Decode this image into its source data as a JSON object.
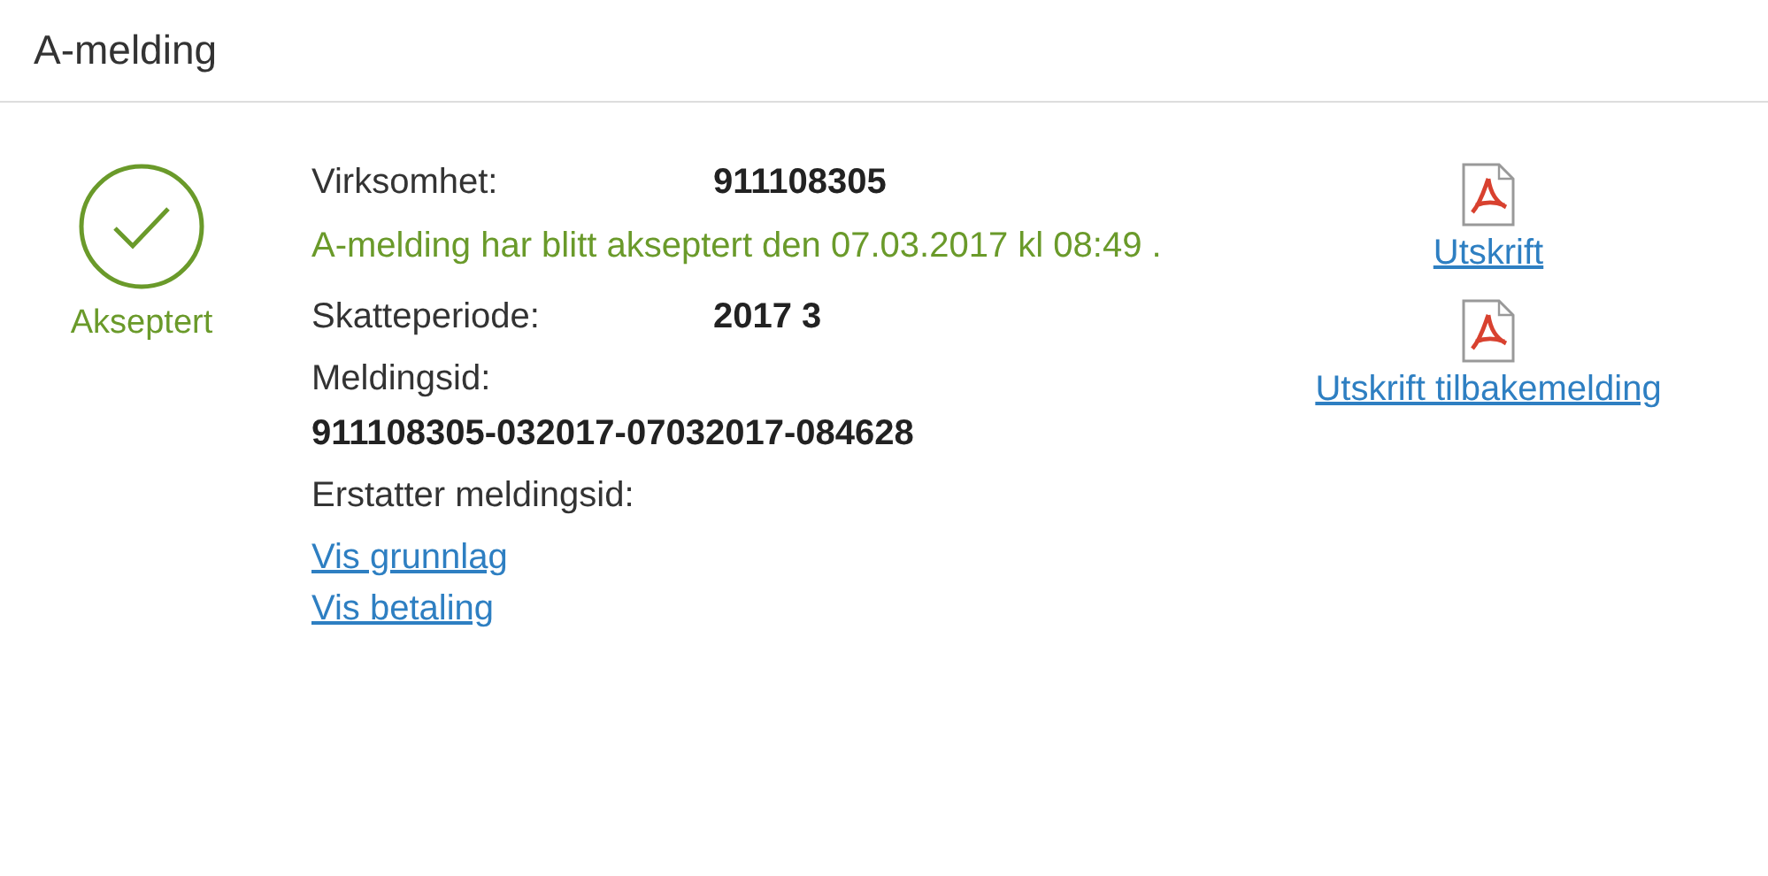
{
  "title": "A-melding",
  "status": {
    "kind": "accepted",
    "label": "Akseptert"
  },
  "details": [
    {
      "kind": "pair",
      "label": "Virksomhet:",
      "value": "911108305"
    },
    {
      "kind": "message",
      "text": "A-melding har blitt akseptert den 07.03.2017 kl 08:49 ."
    },
    {
      "kind": "pair",
      "label": "Skatteperiode:",
      "value": "2017 3"
    },
    {
      "kind": "stacked",
      "label": "Meldingsid:",
      "value": "911108305-032017-07032017-084628"
    },
    {
      "kind": "stacked",
      "label": "Erstatter meldingsid:"
    }
  ],
  "links": [
    "Vis grunnlag",
    "Vis betaling"
  ],
  "documents": [
    {
      "label": "Utskrift"
    },
    {
      "label": "Utskrift tilbakemelding"
    }
  ]
}
